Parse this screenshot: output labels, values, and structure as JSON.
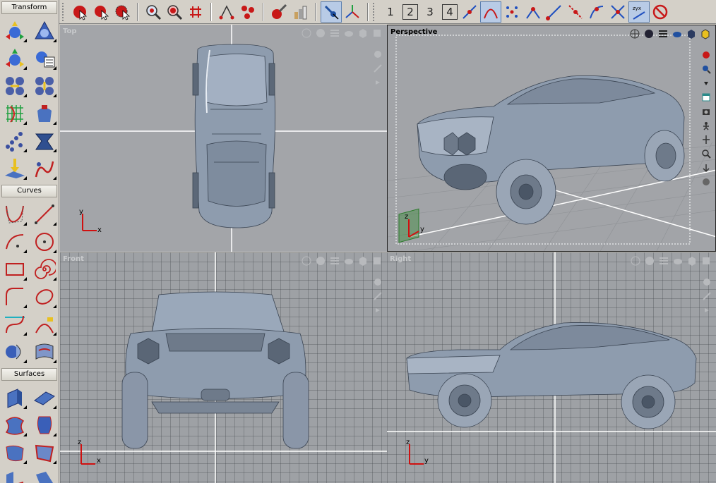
{
  "palettes": {
    "transform": {
      "title": "Transform"
    },
    "curves": {
      "title": "Curves"
    },
    "surfaces": {
      "title": "Surfaces"
    }
  },
  "toolbar": {
    "buttons": [
      "select-icon",
      "lasso-select-icon",
      "select-settings-icon",
      "zoom-in-icon",
      "zoom-out-icon",
      "grid-snap-icon",
      "measure-icon",
      "points-icon",
      "paint-icon",
      "layers-icon",
      "cursor-pointer-icon",
      "axis-icon"
    ],
    "viewport_layout": [
      "1",
      "2",
      "3",
      "4"
    ],
    "snap_buttons": [
      "snap-grid-icon",
      "snap-curve-icon",
      "snap-point-icon",
      "snap-center-icon",
      "snap-end-icon",
      "snap-mid-icon",
      "snap-intersect-icon",
      "snap-tangent-icon",
      "xyz-lock-icon",
      "stop-icon"
    ]
  },
  "viewports": {
    "top": {
      "label": "Top",
      "h_axis": "x",
      "v_axis": "y"
    },
    "perspective": {
      "label": "Perspective",
      "h_axis": "y",
      "v_axis": "z"
    },
    "front": {
      "label": "Front",
      "h_axis": "x",
      "v_axis": "z"
    },
    "right": {
      "label": "Right",
      "h_axis": "y",
      "v_axis": "z"
    }
  },
  "colors": {
    "ui_bg": "#d4d0c8",
    "model": "#8e9cae",
    "axis_red": "#d01010",
    "grid_line": "#ffffff"
  }
}
